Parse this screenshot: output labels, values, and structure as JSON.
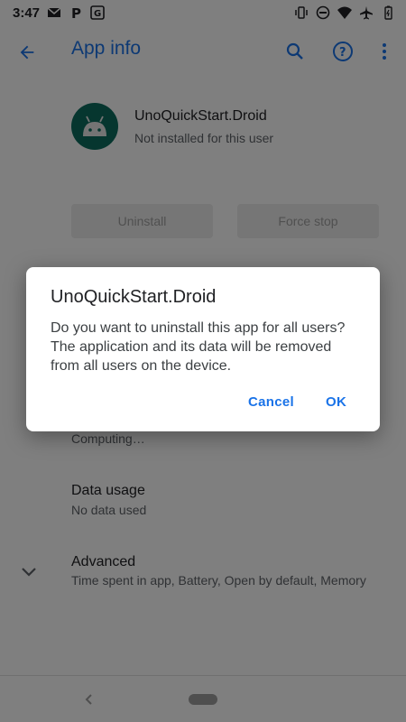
{
  "status_bar": {
    "time": "3:47",
    "left_icons": [
      "gmail-icon",
      "parking-icon",
      "translate-icon"
    ],
    "right_icons": [
      "vibrate-icon",
      "do-not-disturb-icon",
      "wifi-icon",
      "airplane-icon",
      "battery-icon"
    ]
  },
  "app_bar": {
    "title": "App info",
    "back_icon": "arrow-left-icon",
    "actions": [
      "search-icon",
      "help-icon",
      "more-vert-icon"
    ]
  },
  "app": {
    "name": "UnoQuickStart.Droid",
    "status": "Not installed for this user",
    "icon": "android-icon"
  },
  "buttons": {
    "uninstall": "Uninstall",
    "force_stop": "Force stop"
  },
  "list": {
    "storage_sub": "Computing…",
    "data_usage_title": "Data usage",
    "data_usage_sub": "No data used",
    "advanced_title": "Advanced",
    "advanced_sub": "Time spent in app, Battery, Open by default, Memory"
  },
  "dialog": {
    "title": "UnoQuickStart.Droid",
    "message": "Do you want to uninstall this app for all users? The application and its data will be removed from all users on the device.",
    "cancel": "Cancel",
    "ok": "OK"
  },
  "colors": {
    "accent": "#1a73e8",
    "app_icon_bg": "#0c6d5f",
    "scrim": "rgba(0,0,0,0.5)"
  }
}
